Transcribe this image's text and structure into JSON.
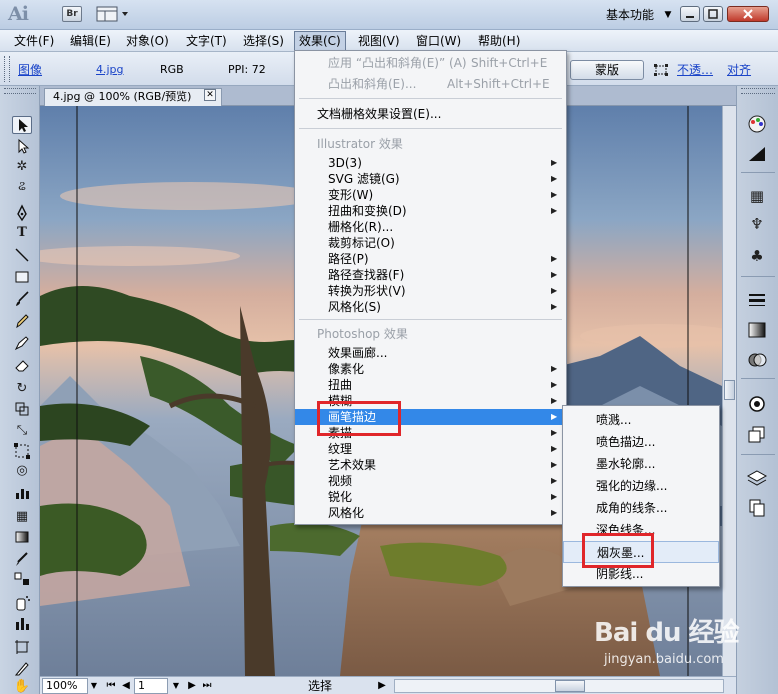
{
  "title_bar": {
    "app_logo": "Ai",
    "bridge_badge": "Br",
    "workspace_label": "基本功能",
    "workspace_arrow": "▼",
    "window_buttons": {
      "minimize": "—",
      "maximize": "☐",
      "close": "✕"
    }
  },
  "menu_bar": {
    "items": [
      "文件(F)",
      "编辑(E)",
      "对象(O)",
      "文字(T)",
      "选择(S)",
      "效果(C)",
      "视图(V)",
      "窗口(W)",
      "帮助(H)"
    ],
    "active": "效果(C)"
  },
  "control_bar": {
    "image_label": "图像",
    "file_link": "4.jpg",
    "color_mode": "RGB",
    "ppi": "PPI: 72",
    "mask_button": "蒙版",
    "opacity_link": "不透…",
    "align_link": "对齐"
  },
  "document": {
    "tab_title": "4.jpg @ 100% (RGB/预览)",
    "tab_close": "✕"
  },
  "status_bar": {
    "zoom": "100%",
    "artboard": "1",
    "status_text": "选择"
  },
  "effect_menu": {
    "apply_last": {
      "label": "应用 “凸出和斜角(E)” (A)",
      "shortcut": "Shift+Ctrl+E"
    },
    "last_effect": {
      "label": "凸出和斜角(E)...",
      "shortcut": "Alt+Shift+Ctrl+E"
    },
    "raster_settings": "文档栅格效果设置(E)...",
    "illustrator_header": "Illustrator 效果",
    "illustrator_items": [
      "3D(3)",
      "SVG 滤镜(G)",
      "变形(W)",
      "扭曲和变换(D)",
      "栅格化(R)...",
      "裁剪标记(O)",
      "路径(P)",
      "路径查找器(F)",
      "转换为形状(V)",
      "风格化(S)"
    ],
    "photoshop_header": "Photoshop 效果",
    "photoshop_items": [
      "效果画廊...",
      "像素化",
      "扭曲",
      "模糊",
      "画笔描边",
      "素描",
      "纹理",
      "艺术效果",
      "视频",
      "锐化",
      "风格化"
    ],
    "highlighted": "画笔描边"
  },
  "submenu": {
    "items": [
      "喷溅...",
      "喷色描边...",
      "墨水轮廓...",
      "强化的边缘...",
      "成角的线条...",
      "深色线条...",
      "烟灰墨...",
      "阴影线..."
    ],
    "highlighted": "烟灰墨..."
  },
  "watermark": {
    "brand": "Bai du 经验",
    "url": "jingyan.baidu.com"
  },
  "colors": {
    "highlight": "#3388e8",
    "annotation_red": "#e0262a"
  }
}
